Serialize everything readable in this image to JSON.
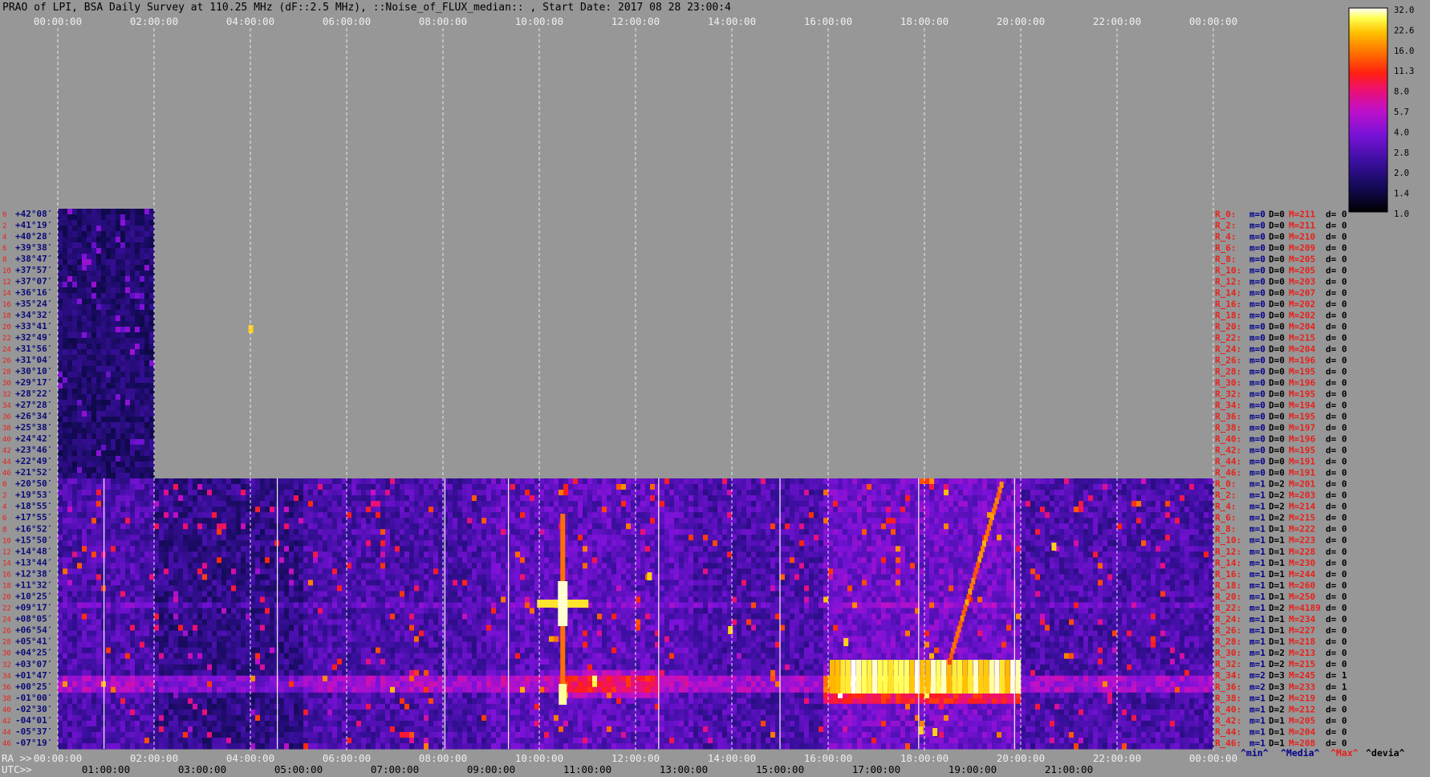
{
  "title": "PRAO of LPI, BSA Daily Survey at 110.25 MHz (dF::2.5 MHz), ::Noise_of_FLUX_median:: , Start Date: 2017 08 28 23:00:4",
  "colors": {
    "background": "#979797",
    "left_labels": "#e8201a",
    "dec_labels": "#0a0a78",
    "stat_label": "#e8201a",
    "stat_blue": "#00008c",
    "stat_black": "#000000"
  },
  "chart_data": {
    "type": "heatmap",
    "top_axis_ticks": [
      "00:00:00",
      "02:00:00",
      "04:00:00",
      "06:00:00",
      "08:00:00",
      "10:00:00",
      "12:00:00",
      "14:00:00",
      "16:00:00",
      "18:00:00",
      "20:00:00",
      "22:00:00",
      "00:00:00"
    ],
    "bottom_ra_label": "RA >>",
    "bottom_ra_ticks": [
      "00:00:00",
      "02:00:00",
      "04:00:00",
      "06:00:00",
      "08:00:00",
      "10:00:00",
      "12:00:00",
      "14:00:00",
      "16:00:00",
      "18:00:00",
      "20:00:00",
      "22:00:00",
      "00:00:00"
    ],
    "bottom_utc_label": "UTC>>",
    "bottom_utc_ticks": [
      "01:00:00",
      "03:00:00",
      "05:00:00",
      "07:00:00",
      "09:00:00",
      "11:00:00",
      "13:00:00",
      "15:00:00",
      "17:00:00",
      "19:00:00",
      "21:00:00"
    ],
    "colorbar_ticks": [
      "32.0",
      "22.6",
      "16.0",
      "11.3",
      "8.0",
      "5.7",
      "4.0",
      "2.8",
      "2.0",
      "1.4",
      "1.0"
    ],
    "bottom_legend": [
      "^min^",
      "^Media^",
      "^Max^",
      "^devia^"
    ],
    "upper_panel": {
      "beam_numbers": [
        "0",
        "2",
        "4",
        "6",
        "8",
        "10",
        "12",
        "14",
        "16",
        "18",
        "20",
        "22",
        "24",
        "26",
        "28",
        "30",
        "32",
        "34",
        "36",
        "38",
        "40",
        "42",
        "44",
        "46"
      ],
      "declinations": [
        "+42°08′",
        "+41°19′",
        "+40°28′",
        "+39°38′",
        "+38°47′",
        "+37°57′",
        "+37°07′",
        "+36°16′",
        "+35°24′",
        "+34°32′",
        "+33°41′",
        "+32°49′",
        "+31°56′",
        "+31°04′",
        "+30°10′",
        "+29°17′",
        "+28°22′",
        "+27°28′",
        "+26°34′",
        "+25°38′",
        "+24°42′",
        "+23°46′",
        "+22°49′",
        "+21°52′"
      ],
      "stats": [
        {
          "r": "R_0:",
          "m": "m=0",
          "D": "D=0",
          "M": "M=211",
          "d": "d= 0"
        },
        {
          "r": "R_2:",
          "m": "m=0",
          "D": "D=0",
          "M": "M=211",
          "d": "d= 0"
        },
        {
          "r": "R_4:",
          "m": "m=0",
          "D": "D=0",
          "M": "M=210",
          "d": "d= 0"
        },
        {
          "r": "R_6:",
          "m": "m=0",
          "D": "D=0",
          "M": "M=209",
          "d": "d= 0"
        },
        {
          "r": "R_8:",
          "m": "m=0",
          "D": "D=0",
          "M": "M=205",
          "d": "d= 0"
        },
        {
          "r": "R_10:",
          "m": "m=0",
          "D": "D=0",
          "M": "M=205",
          "d": "d= 0"
        },
        {
          "r": "R_12:",
          "m": "m=0",
          "D": "D=0",
          "M": "M=203",
          "d": "d= 0"
        },
        {
          "r": "R_14:",
          "m": "m=0",
          "D": "D=0",
          "M": "M=207",
          "d": "d= 0"
        },
        {
          "r": "R_16:",
          "m": "m=0",
          "D": "D=0",
          "M": "M=202",
          "d": "d= 0"
        },
        {
          "r": "R_18:",
          "m": "m=0",
          "D": "D=0",
          "M": "M=202",
          "d": "d= 0"
        },
        {
          "r": "R_20:",
          "m": "m=0",
          "D": "D=0",
          "M": "M=204",
          "d": "d= 0"
        },
        {
          "r": "R_22:",
          "m": "m=0",
          "D": "D=0",
          "M": "M=215",
          "d": "d= 0"
        },
        {
          "r": "R_24:",
          "m": "m=0",
          "D": "D=0",
          "M": "M=204",
          "d": "d= 0"
        },
        {
          "r": "R_26:",
          "m": "m=0",
          "D": "D=0",
          "M": "M=196",
          "d": "d= 0"
        },
        {
          "r": "R_28:",
          "m": "m=0",
          "D": "D=0",
          "M": "M=195",
          "d": "d= 0"
        },
        {
          "r": "R_30:",
          "m": "m=0",
          "D": "D=0",
          "M": "M=196",
          "d": "d= 0"
        },
        {
          "r": "R_32:",
          "m": "m=0",
          "D": "D=0",
          "M": "M=195",
          "d": "d= 0"
        },
        {
          "r": "R_34:",
          "m": "m=0",
          "D": "D=0",
          "M": "M=194",
          "d": "d= 0"
        },
        {
          "r": "R_36:",
          "m": "m=0",
          "D": "D=0",
          "M": "M=195",
          "d": "d= 0"
        },
        {
          "r": "R_38:",
          "m": "m=0",
          "D": "D=0",
          "M": "M=197",
          "d": "d= 0"
        },
        {
          "r": "R_40:",
          "m": "m=0",
          "D": "D=0",
          "M": "M=196",
          "d": "d= 0"
        },
        {
          "r": "R_42:",
          "m": "m=0",
          "D": "D=0",
          "M": "M=195",
          "d": "d= 0"
        },
        {
          "r": "R_44:",
          "m": "m=0",
          "D": "D=0",
          "M": "M=191",
          "d": "d= 0"
        },
        {
          "r": "R_46:",
          "m": "m=0",
          "D": "D=0",
          "M": "M=191",
          "d": "d= 0"
        }
      ]
    },
    "lower_panel": {
      "beam_numbers": [
        "0",
        "2",
        "4",
        "6",
        "8",
        "10",
        "12",
        "14",
        "16",
        "18",
        "20",
        "22",
        "24",
        "26",
        "28",
        "30",
        "32",
        "34",
        "36",
        "38",
        "40",
        "42",
        "44",
        "46"
      ],
      "declinations": [
        "+20°50′",
        "+19°53′",
        "+18°55′",
        "+17°55′",
        "+16°52′",
        "+15°50′",
        "+14°48′",
        "+13°44′",
        "+12°38′",
        "+11°32′",
        "+10°25′",
        "+09°17′",
        "+08°05′",
        "+06°54′",
        "+05°41′",
        "+04°25′",
        "+03°07′",
        "+01°47′",
        "+00°25′",
        "-01°00′",
        "-02°30′",
        "-04°01′",
        "-05°37′",
        "-07°19′"
      ],
      "stats": [
        {
          "r": "R_0:",
          "m": "m=1",
          "D": "D=2",
          "M": "M=201",
          "d": "d= 0"
        },
        {
          "r": "R_2:",
          "m": "m=1",
          "D": "D=2",
          "M": "M=203",
          "d": "d= 0"
        },
        {
          "r": "R_4:",
          "m": "m=1",
          "D": "D=2",
          "M": "M=214",
          "d": "d= 0"
        },
        {
          "r": "R_6:",
          "m": "m=1",
          "D": "D=2",
          "M": "M=215",
          "d": "d= 0"
        },
        {
          "r": "R_8:",
          "m": "m=1",
          "D": "D=1",
          "M": "M=222",
          "d": "d= 0"
        },
        {
          "r": "R_10:",
          "m": "m=1",
          "D": "D=1",
          "M": "M=223",
          "d": "d= 0"
        },
        {
          "r": "R_12:",
          "m": "m=1",
          "D": "D=1",
          "M": "M=228",
          "d": "d= 0"
        },
        {
          "r": "R_14:",
          "m": "m=1",
          "D": "D=1",
          "M": "M=230",
          "d": "d= 0"
        },
        {
          "r": "R_16:",
          "m": "m=1",
          "D": "D=1",
          "M": "M=244",
          "d": "d= 0"
        },
        {
          "r": "R_18:",
          "m": "m=1",
          "D": "D=1",
          "M": "M=260",
          "d": "d= 0"
        },
        {
          "r": "R_20:",
          "m": "m=1",
          "D": "D=1",
          "M": "M=250",
          "d": "d= 0"
        },
        {
          "r": "R_22:",
          "m": "m=1",
          "D": "D=2",
          "M": "M=4189",
          "d": "d= 0"
        },
        {
          "r": "R_24:",
          "m": "m=1",
          "D": "D=1",
          "M": "M=234",
          "d": "d= 0"
        },
        {
          "r": "R_26:",
          "m": "m=1",
          "D": "D=1",
          "M": "M=227",
          "d": "d= 0"
        },
        {
          "r": "R_28:",
          "m": "m=1",
          "D": "D=1",
          "M": "M=218",
          "d": "d= 0"
        },
        {
          "r": "R_30:",
          "m": "m=1",
          "D": "D=2",
          "M": "M=213",
          "d": "d= 0"
        },
        {
          "r": "R_32:",
          "m": "m=1",
          "D": "D=2",
          "M": "M=215",
          "d": "d= 0"
        },
        {
          "r": "R_34:",
          "m": "m=2",
          "D": "D=3",
          "M": "M=245",
          "d": "d= 1"
        },
        {
          "r": "R_36:",
          "m": "m=2",
          "D": "D=3",
          "M": "M=233",
          "d": "d= 1"
        },
        {
          "r": "R_38:",
          "m": "m=1",
          "D": "D=2",
          "M": "M=219",
          "d": "d= 0"
        },
        {
          "r": "R_40:",
          "m": "m=1",
          "D": "D=2",
          "M": "M=212",
          "d": "d= 0"
        },
        {
          "r": "R_42:",
          "m": "m=1",
          "D": "D=1",
          "M": "M=205",
          "d": "d= 0"
        },
        {
          "r": "R_44:",
          "m": "m=1",
          "D": "D=1",
          "M": "M=204",
          "d": "d= 0"
        },
        {
          "r": "R_46:",
          "m": "m=1",
          "D": "D=1",
          "M": "M=208",
          "d": "d= 0"
        }
      ]
    }
  }
}
